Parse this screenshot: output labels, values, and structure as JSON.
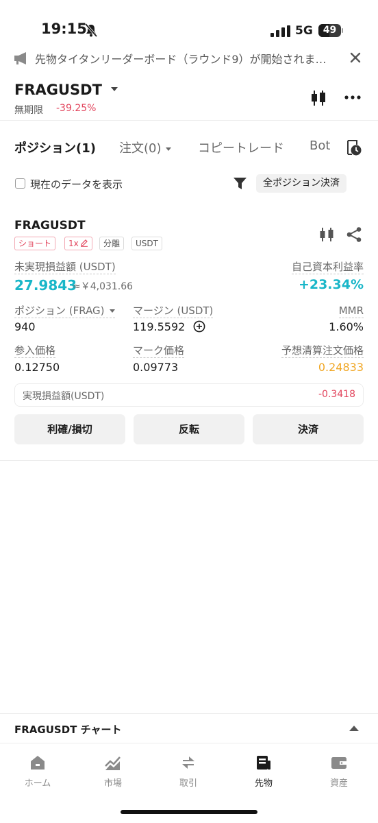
{
  "status": {
    "time": "19:15",
    "network": "5G",
    "battery": "49"
  },
  "announcement": {
    "text": "先物タイタンリーダーボード（ラウンド9）が開始されま…"
  },
  "header": {
    "symbol": "FRAGUSDT",
    "contract_type": "無期限",
    "change": "-39.25%"
  },
  "tabs": [
    {
      "label": "ポジション(1)"
    },
    {
      "label": "注文(0)"
    },
    {
      "label": "コピートレード"
    },
    {
      "label": "Bot"
    }
  ],
  "filter": {
    "show_current_label": "現在のデータを表示",
    "close_all_label": "全ポジション決済"
  },
  "position": {
    "symbol": "FRAGUSDT",
    "tags": {
      "side": "ショート",
      "leverage": "1x",
      "margin_mode": "分離",
      "settle": "USDT"
    },
    "unrealized_label": "未実現損益額 (USDT)",
    "unrealized_value": "27.9843",
    "unrealized_jpy": "≈￥4,031.66",
    "roe_label": "自己資本利益率",
    "roe_value": "+23.34%",
    "size_label": "ポジション (FRAG)",
    "size_value": "940",
    "margin_label": "マージン (USDT)",
    "margin_value": "119.5592",
    "mmr_label": "MMR",
    "mmr_value": "1.60%",
    "entry_label": "参入価格",
    "entry_value": "0.12750",
    "mark_label": "マーク価格",
    "mark_value": "0.09773",
    "liq_label": "予想清算注文価格",
    "liq_value": "0.24833",
    "realized_label": "実現損益額(USDT)",
    "realized_value": "-0.3418",
    "buttons": {
      "tpsl": "利確/損切",
      "reverse": "反転",
      "close": "決済"
    }
  },
  "chart_bar": {
    "label": "FRAGUSDT  チャート"
  },
  "nav": [
    {
      "label": "ホーム",
      "icon": "home-icon"
    },
    {
      "label": "市場",
      "icon": "market-icon"
    },
    {
      "label": "取引",
      "icon": "trade-icon"
    },
    {
      "label": "先物",
      "icon": "futures-icon"
    },
    {
      "label": "資産",
      "icon": "wallet-icon"
    }
  ],
  "colors": {
    "accent_cyan": "#19b6c8",
    "loss_red": "#e2445c",
    "liq_orange": "#f0a623"
  }
}
